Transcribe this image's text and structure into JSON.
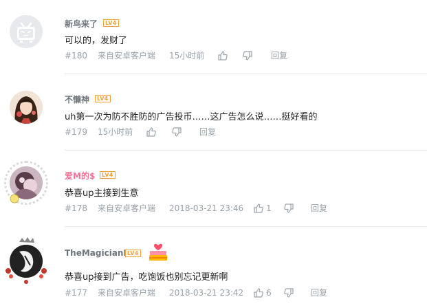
{
  "comments": [
    {
      "username": "新鸟来了",
      "level": "LV4",
      "text": "可以的，发财了",
      "floor": "#180",
      "device": "来自安卓客户端",
      "time": "15小时前",
      "likes": "",
      "reply_label": "回复"
    },
    {
      "username": "不懒神",
      "level": "LV4",
      "text": "uh第一次为防不胜防的广告投币……这广告怎么说……挺好看的",
      "floor": "#179",
      "device": "",
      "time": "15小时前",
      "likes": "",
      "reply_label": "回复"
    },
    {
      "username": "爱M的$",
      "level": "LV4",
      "text": "恭喜up主接到生意",
      "floor": "#178",
      "device": "来自安卓客户端",
      "time": "2018-03-21 23:46",
      "likes": "1",
      "reply_label": "回复"
    },
    {
      "username": "TheMagicianI",
      "level": "LV4",
      "text": "恭喜up接到广告，吃饱饭也别忘记更新啊",
      "floor": "#177",
      "device": "来自安卓客户端",
      "time": "2018-03-21 23:42",
      "likes": "6",
      "reply_label": "回复"
    }
  ],
  "colors": {
    "vip_name": "#fb7299",
    "level_badge": "#f3a034",
    "meta_text": "#99a2aa",
    "divider": "#e5e9ef"
  },
  "icons": [
    "bilibili-tv-avatar-icon",
    "thumb-up-icon",
    "thumb-down-icon",
    "cake-badge-icon"
  ]
}
